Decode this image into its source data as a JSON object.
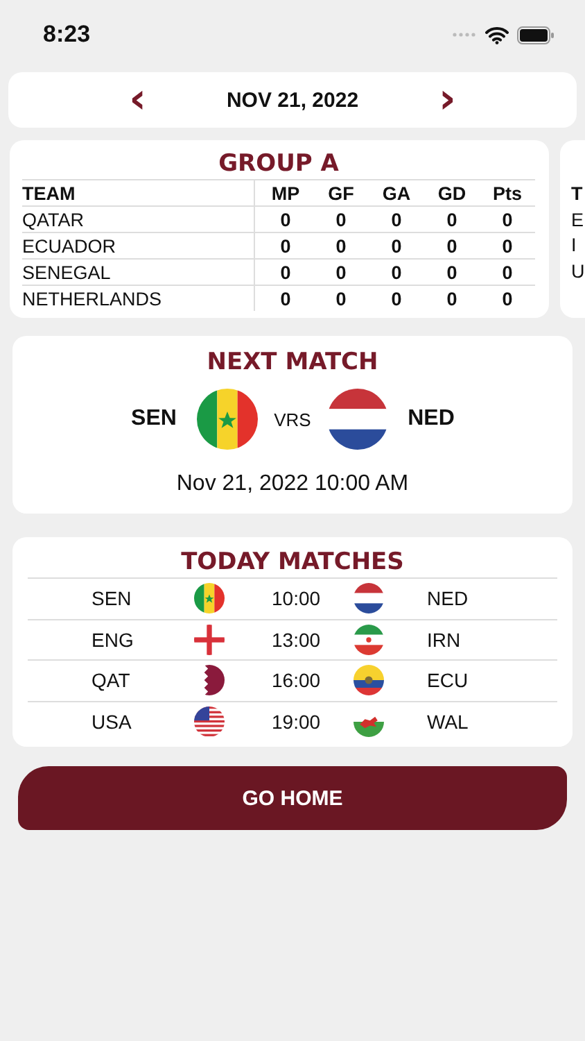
{
  "status_bar": {
    "time": "8:23"
  },
  "date_bar": {
    "date": "NOV 21, 2022",
    "prev": "‹",
    "next": "›"
  },
  "groups": [
    {
      "title": "GROUP A",
      "columns": [
        "TEAM",
        "MP",
        "GF",
        "GA",
        "GD",
        "Pts"
      ],
      "rows": [
        [
          "QATAR",
          "0",
          "0",
          "0",
          "0",
          "0"
        ],
        [
          "ECUADOR",
          "0",
          "0",
          "0",
          "0",
          "0"
        ],
        [
          "SENEGAL",
          "0",
          "0",
          "0",
          "0",
          "0"
        ],
        [
          "NETHERLANDS",
          "0",
          "0",
          "0",
          "0",
          "0"
        ]
      ]
    }
  ],
  "next_group_peek": [
    "T",
    "E",
    "I",
    "U"
  ],
  "next_match": {
    "title": "NEXT MATCH",
    "home": "SEN",
    "home_flag": {
      "kind": "senegal"
    },
    "versus": "VRS",
    "away": "NED",
    "away_flag": {
      "kind": "netherlands"
    },
    "datetime": "Nov 21, 2022 10:00 AM"
  },
  "today_matches": {
    "title": "TODAY MATCHES",
    "matches": [
      {
        "home": "SEN",
        "home_flag": {
          "kind": "senegal"
        },
        "time": "10:00",
        "away": "NED",
        "away_flag": {
          "kind": "netherlands"
        }
      },
      {
        "home": "ENG",
        "home_flag": {
          "kind": "england"
        },
        "time": "13:00",
        "away": "IRN",
        "away_flag": {
          "kind": "iran"
        }
      },
      {
        "home": "QAT",
        "home_flag": {
          "kind": "qatar"
        },
        "time": "16:00",
        "away": "ECU",
        "away_flag": {
          "kind": "ecuador"
        }
      },
      {
        "home": "USA",
        "home_flag": {
          "kind": "usa"
        },
        "time": "19:00",
        "away": "WAL",
        "away_flag": {
          "kind": "wales"
        }
      }
    ]
  },
  "go_home_button": "GO HOME"
}
